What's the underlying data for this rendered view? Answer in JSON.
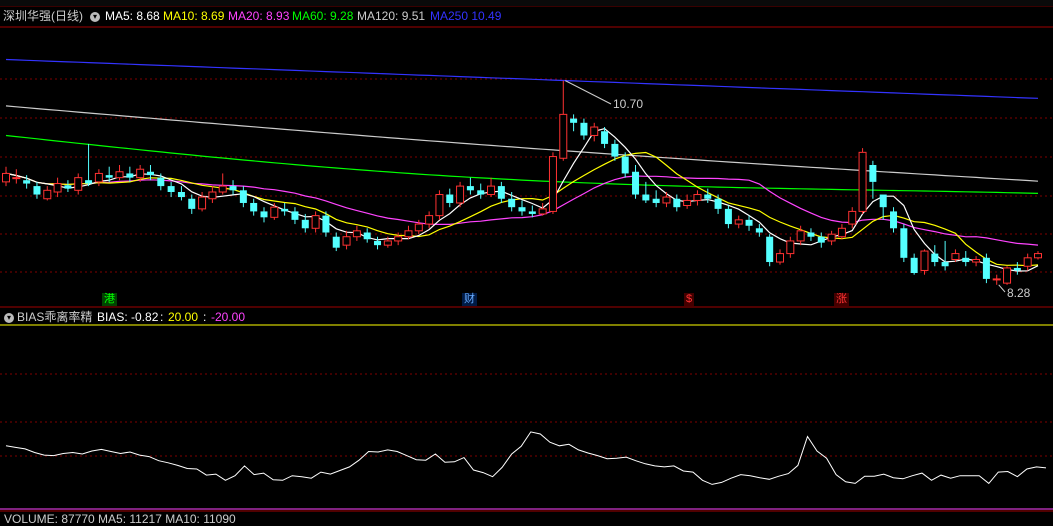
{
  "header": {
    "title": "深圳华强(日线)",
    "indicators": [
      {
        "label": "MA5: 8.68",
        "color": "#ffffff"
      },
      {
        "label": "MA10: 8.69",
        "color": "#ffff00"
      },
      {
        "label": "MA20: 8.93",
        "color": "#ff44ff"
      },
      {
        "label": "MA60: 9.28",
        "color": "#00ff00"
      },
      {
        "label": "MA120: 9.51",
        "color": "#cccccc"
      },
      {
        "label": "MA250  10.49",
        "color": "#3333ff"
      }
    ]
  },
  "events": [
    {
      "label": "港",
      "color": "#00ff00",
      "bg": "#004400"
    },
    {
      "label": "财",
      "color": "#66aaff",
      "bg": "#001a44"
    },
    {
      "label": "$",
      "color": "#ff3333",
      "bg": "#440000"
    },
    {
      "label": "涨",
      "color": "#ff3333",
      "bg": "#440000"
    }
  ],
  "bias_header": {
    "name": "BIAS乖离率精",
    "value": "BIAS: -0.82",
    "upper": "20.00",
    "lower": "-20.00"
  },
  "volume_header": {
    "text": "VOLUME: 87770  MA5: 11217  MA10: 11090"
  },
  "colors": {
    "up": "#ff3232",
    "down": "#54ffff",
    "grid": "#800000",
    "ma5": "#ffffff",
    "ma10": "#ffff00",
    "ma20": "#ff44ff",
    "ma60": "#00ff00",
    "ma120": "#cccccc",
    "ma250": "#3333ff",
    "bias_line": "#ffffff",
    "bias_upper": "#ffff00",
    "bias_lower": "#ff44ff"
  },
  "chart_data": {
    "type": "candlestick",
    "high_marker": "10.70",
    "low_marker": "8.28",
    "ylim": [
      8.1,
      11.3
    ],
    "candles": [
      [
        9.5,
        9.6,
        9.68,
        9.45
      ],
      [
        9.55,
        9.55,
        9.65,
        9.48
      ],
      [
        9.52,
        9.48,
        9.58,
        9.42
      ],
      [
        9.45,
        9.35,
        9.5,
        9.3
      ],
      [
        9.3,
        9.4,
        9.45,
        9.28
      ],
      [
        9.38,
        9.48,
        9.55,
        9.32
      ],
      [
        9.46,
        9.42,
        9.52,
        9.38
      ],
      [
        9.4,
        9.55,
        9.6,
        9.35
      ],
      [
        9.52,
        9.48,
        9.95,
        9.45
      ],
      [
        9.5,
        9.6,
        9.65,
        9.45
      ],
      [
        9.58,
        9.55,
        9.68,
        9.5
      ],
      [
        9.55,
        9.62,
        9.7,
        9.52
      ],
      [
        9.6,
        9.55,
        9.68,
        9.5
      ],
      [
        9.55,
        9.65,
        9.7,
        9.5
      ],
      [
        9.62,
        9.58,
        9.7,
        9.52
      ],
      [
        9.55,
        9.45,
        9.6,
        9.4
      ],
      [
        9.45,
        9.38,
        9.5,
        9.32
      ],
      [
        9.38,
        9.32,
        9.45,
        9.28
      ],
      [
        9.3,
        9.18,
        9.35,
        9.12
      ],
      [
        9.18,
        9.32,
        9.38,
        9.15
      ],
      [
        9.3,
        9.38,
        9.45,
        9.25
      ],
      [
        9.38,
        9.45,
        9.6,
        9.35
      ],
      [
        9.45,
        9.4,
        9.52,
        9.35
      ],
      [
        9.4,
        9.25,
        9.45,
        9.2
      ],
      [
        9.25,
        9.15,
        9.3,
        9.1
      ],
      [
        9.15,
        9.08,
        9.2,
        9.02
      ],
      [
        9.08,
        9.2,
        9.25,
        9.05
      ],
      [
        9.18,
        9.15,
        9.25,
        9.1
      ],
      [
        9.15,
        9.05,
        9.2,
        9.0
      ],
      [
        9.05,
        8.95,
        9.12,
        8.9
      ],
      [
        8.95,
        9.1,
        9.15,
        8.9
      ],
      [
        9.1,
        8.9,
        9.15,
        8.85
      ],
      [
        8.85,
        8.72,
        8.9,
        8.68
      ],
      [
        8.75,
        8.85,
        8.92,
        8.7
      ],
      [
        8.85,
        8.92,
        8.98,
        8.8
      ],
      [
        8.9,
        8.82,
        8.95,
        8.78
      ],
      [
        8.8,
        8.75,
        8.85,
        8.7
      ],
      [
        8.75,
        8.8,
        8.85,
        8.72
      ],
      [
        8.8,
        8.85,
        8.9,
        8.75
      ],
      [
        8.85,
        8.92,
        8.98,
        8.82
      ],
      [
        8.92,
        9.0,
        9.05,
        8.88
      ],
      [
        9.0,
        9.1,
        9.15,
        8.95
      ],
      [
        9.1,
        9.35,
        9.4,
        9.05
      ],
      [
        9.35,
        9.25,
        9.42,
        9.2
      ],
      [
        9.25,
        9.45,
        9.5,
        9.2
      ],
      [
        9.45,
        9.4,
        9.55,
        9.35
      ],
      [
        9.4,
        9.35,
        9.48,
        9.3
      ],
      [
        9.35,
        9.45,
        9.55,
        9.32
      ],
      [
        9.45,
        9.3,
        9.5,
        9.25
      ],
      [
        9.3,
        9.2,
        9.38,
        9.15
      ],
      [
        9.2,
        9.15,
        9.28,
        9.1
      ],
      [
        9.15,
        9.12,
        9.22,
        9.08
      ],
      [
        9.12,
        9.18,
        9.25,
        9.1
      ],
      [
        9.15,
        9.8,
        9.85,
        9.12
      ],
      [
        9.78,
        10.3,
        10.7,
        9.75
      ],
      [
        10.25,
        10.2,
        10.3,
        10.1
      ],
      [
        10.2,
        10.05,
        10.25,
        10.0
      ],
      [
        10.05,
        10.15,
        10.2,
        9.98
      ],
      [
        10.1,
        9.95,
        10.15,
        9.9
      ],
      [
        9.95,
        9.8,
        10.0,
        9.75
      ],
      [
        9.8,
        9.6,
        9.85,
        9.55
      ],
      [
        9.62,
        9.35,
        9.7,
        9.3
      ],
      [
        9.35,
        9.28,
        9.5,
        9.25
      ],
      [
        9.3,
        9.25,
        9.4,
        9.2
      ],
      [
        9.25,
        9.32,
        9.38,
        9.2
      ],
      [
        9.3,
        9.2,
        9.35,
        9.15
      ],
      [
        9.22,
        9.28,
        9.35,
        9.18
      ],
      [
        9.28,
        9.35,
        9.4,
        9.22
      ],
      [
        9.35,
        9.3,
        9.42,
        9.25
      ],
      [
        9.3,
        9.18,
        9.35,
        9.12
      ],
      [
        9.18,
        9.0,
        9.22,
        8.95
      ],
      [
        9.0,
        9.05,
        9.1,
        8.95
      ],
      [
        9.05,
        8.98,
        9.1,
        8.92
      ],
      [
        8.95,
        8.9,
        9.0,
        8.85
      ],
      [
        8.85,
        8.55,
        8.88,
        8.5
      ],
      [
        8.55,
        8.65,
        8.7,
        8.52
      ],
      [
        8.65,
        8.8,
        8.85,
        8.6
      ],
      [
        8.8,
        8.92,
        8.98,
        8.75
      ],
      [
        8.9,
        8.85,
        8.95,
        8.8
      ],
      [
        8.85,
        8.78,
        8.9,
        8.72
      ],
      [
        8.8,
        8.88,
        8.92,
        8.75
      ],
      [
        8.85,
        8.95,
        9.0,
        8.82
      ],
      [
        9.0,
        9.15,
        9.2,
        8.95
      ],
      [
        9.15,
        9.85,
        9.9,
        9.12
      ],
      [
        9.7,
        9.5,
        9.75,
        9.3
      ],
      [
        9.35,
        9.2,
        9.3,
        9.05
      ],
      [
        9.15,
        8.95,
        9.2,
        8.9
      ],
      [
        8.95,
        8.6,
        9.0,
        8.55
      ],
      [
        8.6,
        8.42,
        8.65,
        8.4
      ],
      [
        8.45,
        8.68,
        8.7,
        8.4
      ],
      [
        8.65,
        8.55,
        8.75,
        8.5
      ],
      [
        8.55,
        8.5,
        8.8,
        8.45
      ],
      [
        8.58,
        8.65,
        8.7,
        8.55
      ],
      [
        8.6,
        8.55,
        8.68,
        8.5
      ],
      [
        8.55,
        8.58,
        8.62,
        8.5
      ],
      [
        8.6,
        8.35,
        8.65,
        8.3
      ],
      [
        8.35,
        8.35,
        8.4,
        8.28
      ],
      [
        8.3,
        8.48,
        8.5,
        8.28
      ],
      [
        8.48,
        8.45,
        8.55,
        8.4
      ],
      [
        8.5,
        8.6,
        8.65,
        8.45
      ],
      [
        8.6,
        8.65,
        8.68,
        8.58
      ]
    ],
    "bias": [
      -0.5,
      -0.8,
      -1.1,
      -1.8,
      -2.3,
      -2.4,
      -2.0,
      -1.8,
      -2.1,
      -1.5,
      -1.2,
      -1.6,
      -2.0,
      -1.7,
      -2.3,
      -2.6,
      -3.4,
      -3.8,
      -4.3,
      -4.9,
      -5.0,
      -6.2,
      -6.0,
      -7.2,
      -6.3,
      -4.4,
      -6.1,
      -5.8,
      -7.1,
      -7.2,
      -6.3,
      -6.5,
      -6.8,
      -5.6,
      -6.0,
      -5.3,
      -4.6,
      -3.3,
      -1.6,
      -1.7,
      -1.3,
      -1.6,
      -2.4,
      -3.2,
      -3.3,
      -2.1,
      -3.7,
      -3.6,
      -2.8,
      -5.2,
      -5.7,
      -6.5,
      -4.7,
      -2.1,
      -0.6,
      2.2,
      1.8,
      0.2,
      -0.5,
      -0.2,
      -1.3,
      -1.9,
      -2.4,
      -3.0,
      -2.9,
      -2.7,
      -3.4,
      -4.0,
      -4.4,
      -4.6,
      -4.4,
      -5.4,
      -5.6,
      -7.2,
      -8.0,
      -7.6,
      -6.8,
      -6.1,
      -6.3,
      -6.7,
      -7.0,
      -6.4,
      -5.9,
      -4.3,
      1.3,
      -1.5,
      -2.9,
      -6.1,
      -7.5,
      -7.8,
      -6.4,
      -6.4,
      -6.0,
      -6.7,
      -6.9,
      -6.3,
      -5.8,
      -7.2,
      -6.2,
      -6.8,
      -6.3,
      -6.3,
      -6.3,
      -7.8,
      -5.6,
      -5.5,
      -6.5,
      -5.0,
      -4.6,
      -4.8
    ],
    "bias_ylim": [
      -12,
      22
    ]
  }
}
